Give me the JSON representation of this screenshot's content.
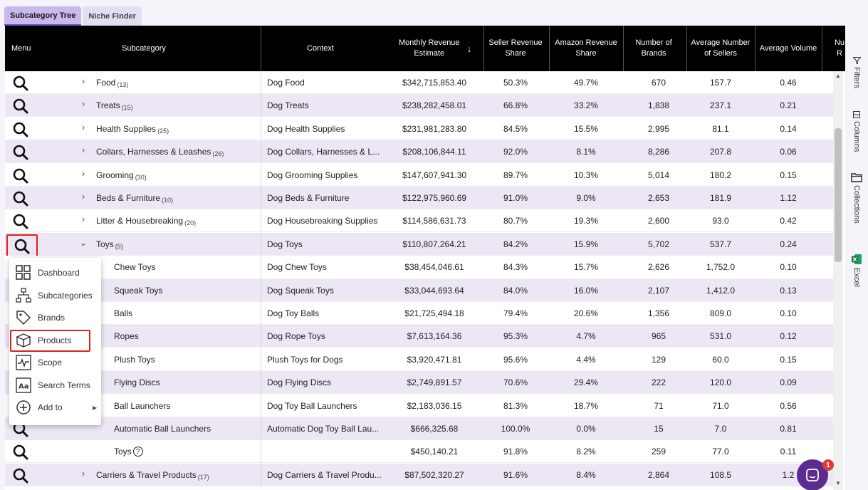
{
  "tabs": [
    {
      "label": "Subcategory Tree",
      "active": true
    },
    {
      "label": "Niche Finder",
      "active": false
    }
  ],
  "columns": {
    "menu": "Menu",
    "subcategory": "Subcategory",
    "context": "Context",
    "monthly_revenue": "Monthly Revenue Estimate",
    "seller_share": "Seller Revenue Share",
    "amazon_share": "Amazon Revenue Share",
    "brands": "Number of Brands",
    "avg_sellers": "Average Number of Sellers",
    "avg_volume": "Average Volume",
    "partial": "Nu R"
  },
  "rows": [
    {
      "name": "Food",
      "count": "(13)",
      "context": "Dog Food",
      "revenue": "$342,715,853.40",
      "seller": "50.3%",
      "amazon": "49.7%",
      "brands": "670",
      "sellers": "157.7",
      "volume": "0.46"
    },
    {
      "name": "Treats",
      "count": "(15)",
      "context": "Dog Treats",
      "revenue": "$238,282,458.01",
      "seller": "66.8%",
      "amazon": "33.2%",
      "brands": "1,838",
      "sellers": "237.1",
      "volume": "0.21"
    },
    {
      "name": "Health Supplies",
      "count": "(25)",
      "context": "Dog Health Supplies",
      "revenue": "$231,981,283.80",
      "seller": "84.5%",
      "amazon": "15.5%",
      "brands": "2,995",
      "sellers": "81.1",
      "volume": "0.14"
    },
    {
      "name": "Collars, Harnesses & Leashes",
      "count": "(26)",
      "context": "Dog Collars, Harnesses & L...",
      "revenue": "$208,106,844.11",
      "seller": "92.0%",
      "amazon": "8.1%",
      "brands": "8,286",
      "sellers": "207.8",
      "volume": "0.06"
    },
    {
      "name": "Grooming",
      "count": "(30)",
      "context": "Dog Grooming Supplies",
      "revenue": "$147,607,941.30",
      "seller": "89.7%",
      "amazon": "10.3%",
      "brands": "5,014",
      "sellers": "180.2",
      "volume": "0.15"
    },
    {
      "name": "Beds & Furniture",
      "count": "(10)",
      "context": "Dog Beds & Furniture",
      "revenue": "$122,975,960.69",
      "seller": "91.0%",
      "amazon": "9.0%",
      "brands": "2,653",
      "sellers": "181.9",
      "volume": "1.12"
    },
    {
      "name": "Litter & Housebreaking",
      "count": "(20)",
      "context": "Dog Housebreaking Supplies",
      "revenue": "$114,586,631.73",
      "seller": "80.7%",
      "amazon": "19.3%",
      "brands": "2,600",
      "sellers": "93.0",
      "volume": "0.42"
    },
    {
      "name": "Toys",
      "count": "(9)",
      "context": "Dog Toys",
      "revenue": "$110,807,264.21",
      "seller": "84.2%",
      "amazon": "15.9%",
      "brands": "5,702",
      "sellers": "537.7",
      "volume": "0.24"
    },
    {
      "name": "Chew Toys",
      "count": "",
      "context": "Dog Chew Toys",
      "revenue": "$38,454,046.61",
      "seller": "84.3%",
      "amazon": "15.7%",
      "brands": "2,626",
      "sellers": "1,752.0",
      "volume": "0.10"
    },
    {
      "name": "Squeak Toys",
      "count": "",
      "context": "Dog Squeak Toys",
      "revenue": "$33,044,693.64",
      "seller": "84.0%",
      "amazon": "16.0%",
      "brands": "2,107",
      "sellers": "1,412.0",
      "volume": "0.13"
    },
    {
      "name": "Balls",
      "count": "",
      "context": "Dog Toy Balls",
      "revenue": "$21,725,494.18",
      "seller": "79.4%",
      "amazon": "20.6%",
      "brands": "1,356",
      "sellers": "809.0",
      "volume": "0.10"
    },
    {
      "name": "Ropes",
      "count": "",
      "context": "Dog Rope Toys",
      "revenue": "$7,613,164.36",
      "seller": "95.3%",
      "amazon": "4.7%",
      "brands": "965",
      "sellers": "531.0",
      "volume": "0.12"
    },
    {
      "name": "Plush Toys",
      "count": "",
      "context": "Plush Toys for Dogs",
      "revenue": "$3,920,471.81",
      "seller": "95.6%",
      "amazon": "4.4%",
      "brands": "129",
      "sellers": "60.0",
      "volume": "0.15"
    },
    {
      "name": "Flying Discs",
      "count": "",
      "context": "Dog Flying Discs",
      "revenue": "$2,749,891.57",
      "seller": "70.6%",
      "amazon": "29.4%",
      "brands": "222",
      "sellers": "120.0",
      "volume": "0.09"
    },
    {
      "name": "Ball Launchers",
      "count": "",
      "context": "Dog Toy Ball Launchers",
      "revenue": "$2,183,036.15",
      "seller": "81.3%",
      "amazon": "18.7%",
      "brands": "71",
      "sellers": "71.0",
      "volume": "0.56"
    },
    {
      "name": "Automatic Ball Launchers",
      "count": "",
      "context": "Automatic Dog Toy Ball Lau...",
      "revenue": "$666,325.68",
      "seller": "100.0%",
      "amazon": "0.0%",
      "brands": "15",
      "sellers": "7.0",
      "volume": "0.81"
    },
    {
      "name": "Toys",
      "count": "",
      "context": "",
      "revenue": "$450,140.21",
      "seller": "91.8%",
      "amazon": "8.2%",
      "brands": "259",
      "sellers": "77.0",
      "volume": "0.11"
    },
    {
      "name": "Carriers & Travel Products",
      "count": "(17)",
      "context": "Dog Carriers & Travel Produ...",
      "revenue": "$87,502,320.27",
      "seller": "91.6%",
      "amazon": "8.4%",
      "brands": "2,864",
      "sellers": "108.5",
      "volume": "1.2"
    }
  ],
  "menu": {
    "items": [
      {
        "label": "Dashboard"
      },
      {
        "label": "Subcategories"
      },
      {
        "label": "Brands"
      },
      {
        "label": "Products"
      },
      {
        "label": "Scope"
      },
      {
        "label": "Search Terms"
      },
      {
        "label": "Add to"
      }
    ]
  },
  "sidebar": {
    "filters": "Filters",
    "columns": "Columns",
    "collections": "Collections",
    "excel": "Excel"
  },
  "chat": {
    "badge": "1"
  },
  "colors": {
    "header_bg": "#000000",
    "row_alt": "#ece6f5",
    "tab_active": "#c9b8ec",
    "highlight": "#e02020",
    "chat": "#5b2d91",
    "excel_green": "#1d6f42"
  }
}
